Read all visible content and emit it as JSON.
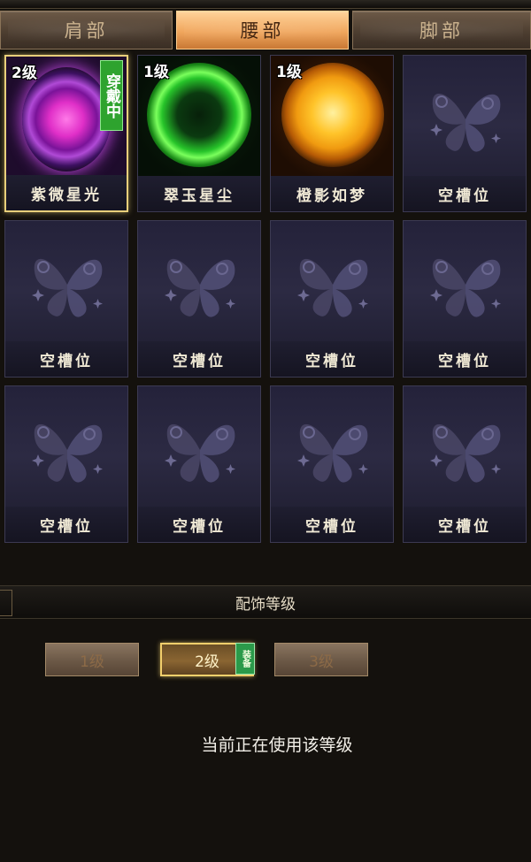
{
  "tabs": [
    {
      "label": "肩部",
      "active": false
    },
    {
      "label": "腰部",
      "active": true
    },
    {
      "label": "脚部",
      "active": false
    }
  ],
  "slots": [
    {
      "level": "2级",
      "name": "紫微星光",
      "wearing": "穿戴中",
      "orb": "purple",
      "selected": true
    },
    {
      "level": "1级",
      "name": "翠玉星尘",
      "orb": "green"
    },
    {
      "level": "1级",
      "name": "橙影如梦",
      "orb": "orange"
    },
    {
      "name": "空槽位"
    },
    {
      "name": "空槽位"
    },
    {
      "name": "空槽位"
    },
    {
      "name": "空槽位"
    },
    {
      "name": "空槽位"
    },
    {
      "name": "空槽位"
    },
    {
      "name": "空槽位"
    },
    {
      "name": "空槽位"
    },
    {
      "name": "空槽位"
    }
  ],
  "level_section": {
    "title": "配饰等级",
    "buttons": [
      "1级",
      "2级",
      "3级"
    ],
    "active_index": 1,
    "equip_badge": "装备",
    "status": "当前正在使用该等级"
  },
  "colors": {
    "active_tab": "#f0a65d",
    "selected_border": "#e8cf7a",
    "wearing_badge": "#2ea32e",
    "slot_bg": "#2c2a43"
  },
  "icons": {
    "empty_slot": "butterfly-placeholder-icon"
  }
}
